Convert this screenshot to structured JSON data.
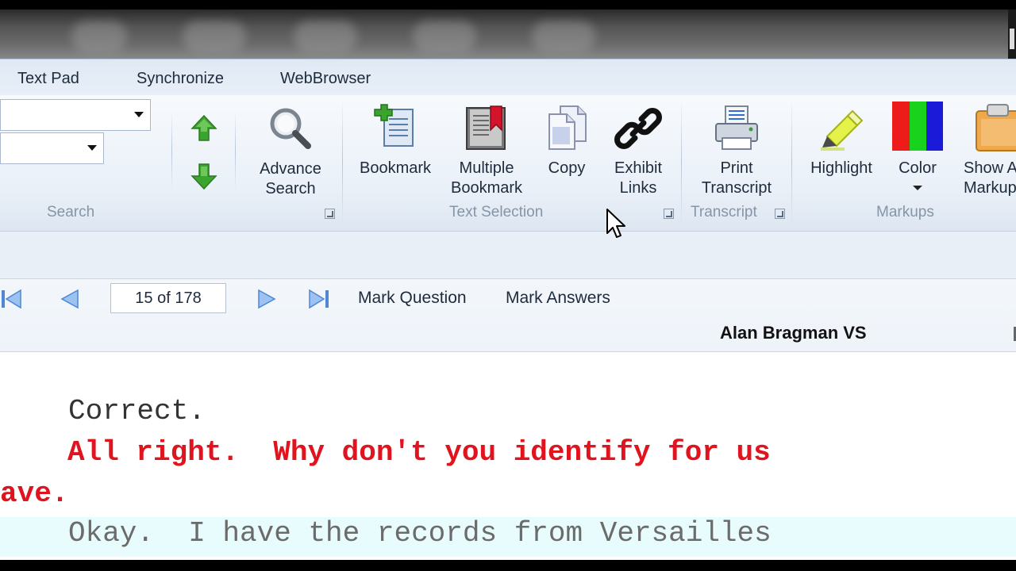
{
  "tabs": [
    "Text Pad",
    "Synchronize",
    "WebBrowser"
  ],
  "ribbon": {
    "search_group_label": "Search",
    "advance_search_label": [
      "Advance",
      "Search"
    ],
    "bookmark_label": "Bookmark",
    "multiple_bookmark_label": [
      "Multiple",
      "Bookmark"
    ],
    "copy_label": "Copy",
    "exhibit_links_label": [
      "Exhibit",
      "Links"
    ],
    "text_selection_group_label": "Text Selection",
    "print_transcript_label": [
      "Print",
      "Transcript"
    ],
    "transcript_group_label": "Transcript",
    "highlight_label": "Highlight",
    "color_label": "Color",
    "show_markup_label": [
      "Show A",
      "Markup"
    ],
    "markups_group_label": "Markups"
  },
  "nav": {
    "page_indicator": "15 of 178",
    "mark_question_label": "Mark Question",
    "mark_answers_label": "Mark Answers",
    "witness_name": "Alan Bragman VS"
  },
  "transcript": {
    "lines": [
      "Correct.",
      "All right.  Why don't you identify for us",
      "ave.",
      "Okay.  I have the records from Versailles"
    ]
  },
  "colors": {
    "answer_text": "#333333",
    "question_text": "#e0141e",
    "ribbon_bg": "#eaf0f8",
    "highlight_row": "#e8fbfd"
  },
  "icons": {
    "up": "arrow-up-green",
    "down": "arrow-down-green",
    "search": "magnifier",
    "bookmark": "bookmark-plus",
    "multiple_bookmark": "book-red-ribbon",
    "copy": "copy-pages",
    "exhibit": "chain-link",
    "print": "printer",
    "highlight": "highlighter",
    "color": "color-bars",
    "markup": "clipboard"
  }
}
